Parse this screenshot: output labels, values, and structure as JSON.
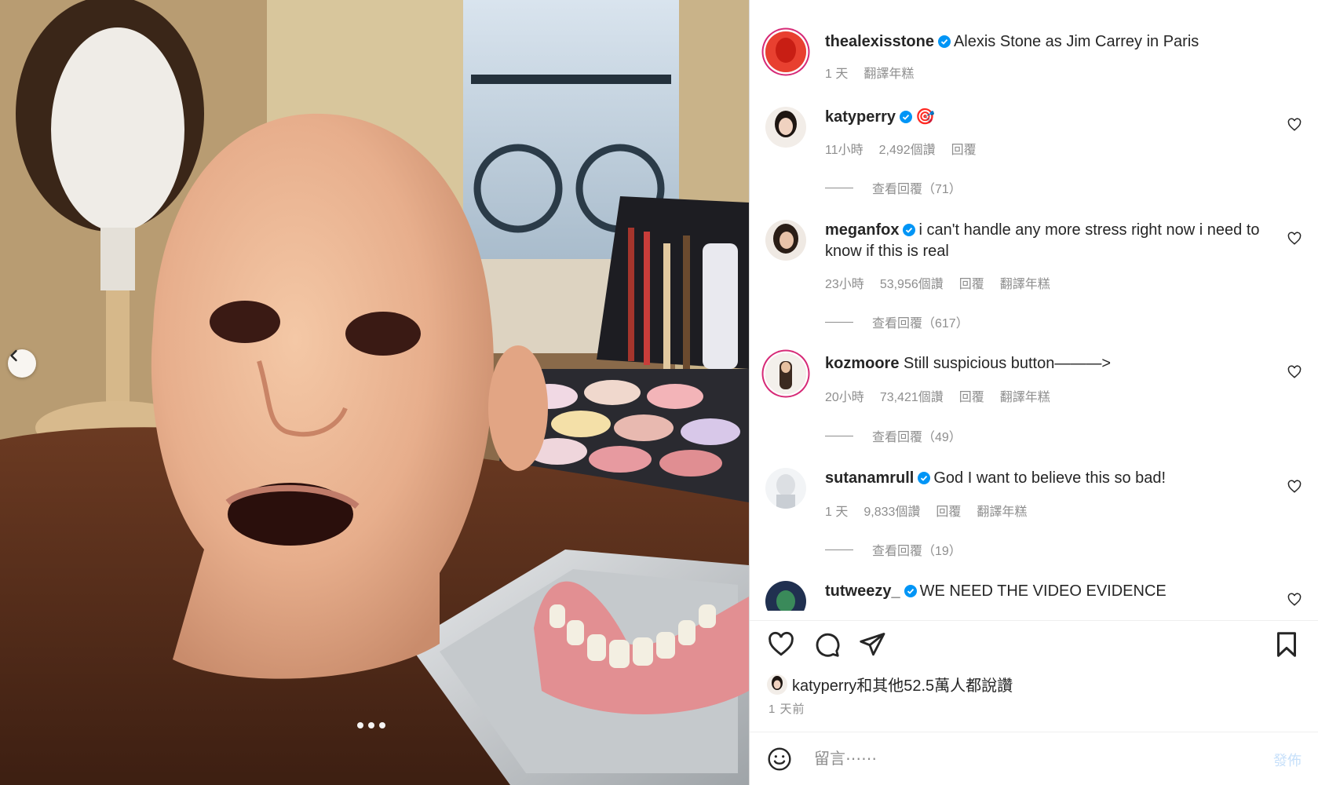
{
  "post": {
    "author": "thealexisstone",
    "caption": "Alexis Stone as Jim Carrey in Paris",
    "time": "1 天",
    "translate": "翻譯年糕"
  },
  "comments": [
    {
      "user": "katyperry",
      "text": "🎯",
      "time": "11小時",
      "likes": "2,492個讚",
      "reply": "回覆",
      "translate": "",
      "view_replies": "查看回覆（71）"
    },
    {
      "user": "meganfox",
      "text": "i can't handle any more stress right now i need to know if this is real",
      "time": "23小時",
      "likes": "53,956個讚",
      "reply": "回覆",
      "translate": "翻譯年糕",
      "view_replies": "查看回覆（617）"
    },
    {
      "user": "kozmoore",
      "text": "Still suspicious button———>",
      "time": "20小時",
      "likes": "73,421個讚",
      "reply": "回覆",
      "translate": "翻譯年糕",
      "view_replies": "查看回覆（49）"
    },
    {
      "user": "sutanamrull",
      "text": "God I want to believe this so bad!",
      "time": "1 天",
      "likes": "9,833個讚",
      "reply": "回覆",
      "translate": "翻譯年糕",
      "view_replies": "查看回覆（19）"
    },
    {
      "user": "tutweezy_",
      "text": "WE NEED THE VIDEO EVIDENCE"
    }
  ],
  "likes_summary": "katyperry和其他52.5萬人都說讚",
  "posted_ago": "1 天前",
  "composer": {
    "placeholder": "留言⋯⋯",
    "post_label": "發佈"
  },
  "colors": {
    "verified": "#0095f6",
    "muted": "#8e8e8e",
    "ring": "#d62976"
  },
  "icons": [
    "chevron-left-icon",
    "heart-icon",
    "comment-icon",
    "share-icon",
    "bookmark-icon",
    "emoji-icon",
    "verified-badge-icon"
  ]
}
